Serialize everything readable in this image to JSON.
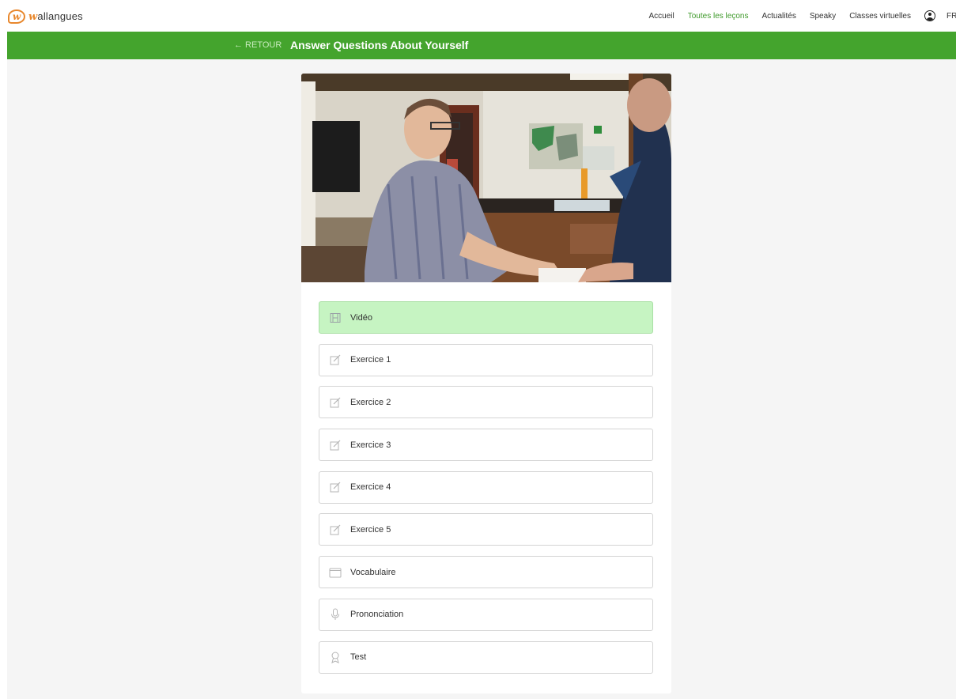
{
  "brand": {
    "badge": "w",
    "initial": "w",
    "rest": "allangues"
  },
  "nav": {
    "items": [
      {
        "label": "Accueil",
        "active": false
      },
      {
        "label": "Toutes les leçons",
        "active": true
      },
      {
        "label": "Actualités",
        "active": false
      },
      {
        "label": "Speaky",
        "active": false
      },
      {
        "label": "Classes virtuelles",
        "active": false
      }
    ],
    "language": "FR"
  },
  "header": {
    "back_label": "← RETOUR",
    "title": "Answer Questions About Yourself"
  },
  "colors": {
    "accent_green": "#44a42d",
    "active_nav": "#3f9a2b",
    "completed_item_bg": "#c6f4c2",
    "brand_orange": "#e8872c"
  },
  "lessons": [
    {
      "label": "Vidéo",
      "icon": "film-icon",
      "completed": true
    },
    {
      "label": "Exercice 1",
      "icon": "edit-icon",
      "completed": false
    },
    {
      "label": "Exercice 2",
      "icon": "edit-icon",
      "completed": false
    },
    {
      "label": "Exercice 3",
      "icon": "edit-icon",
      "completed": false
    },
    {
      "label": "Exercice 4",
      "icon": "edit-icon",
      "completed": false
    },
    {
      "label": "Exercice 5",
      "icon": "edit-icon",
      "completed": false
    },
    {
      "label": "Vocabulaire",
      "icon": "folder-icon",
      "completed": false
    },
    {
      "label": "Prononciation",
      "icon": "microphone-icon",
      "completed": false
    },
    {
      "label": "Test",
      "icon": "award-icon",
      "completed": false
    }
  ]
}
